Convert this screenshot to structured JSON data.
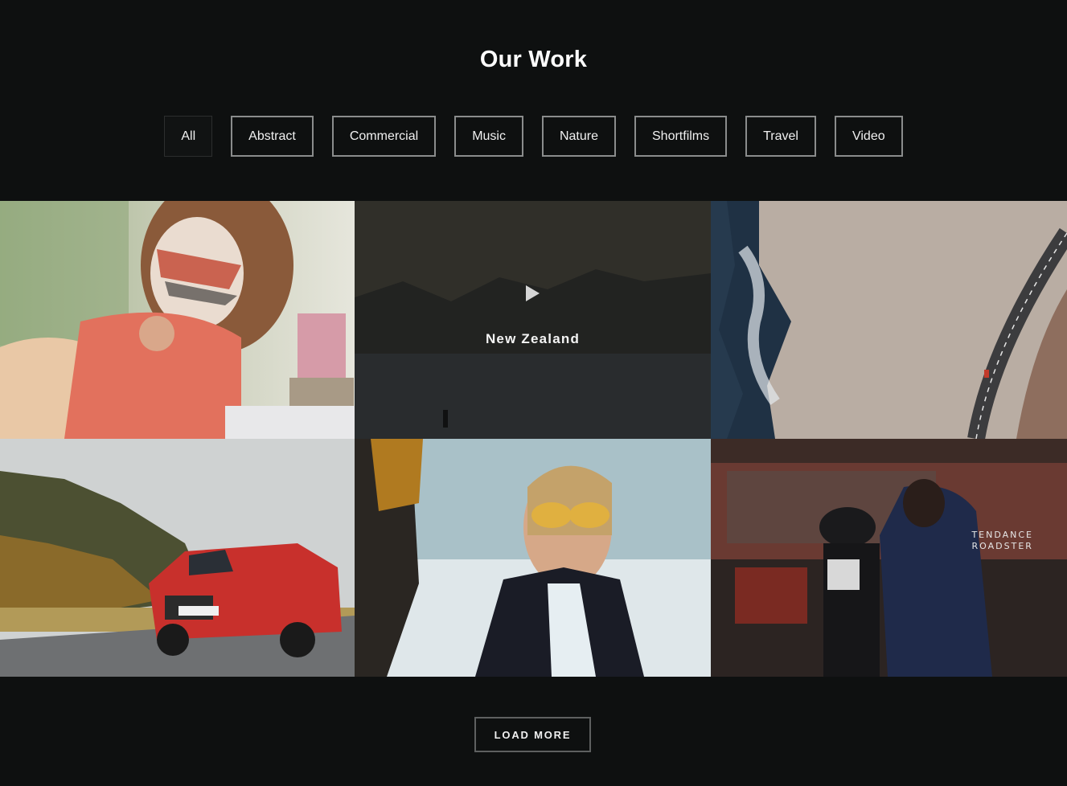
{
  "section": {
    "title": "Our Work"
  },
  "filters": [
    {
      "label": "All",
      "active": true
    },
    {
      "label": "Abstract",
      "active": false
    },
    {
      "label": "Commercial",
      "active": false
    },
    {
      "label": "Music",
      "active": false
    },
    {
      "label": "Nature",
      "active": false
    },
    {
      "label": "Shortfilms",
      "active": false
    },
    {
      "label": "Travel",
      "active": false
    },
    {
      "label": "Video",
      "active": false
    }
  ],
  "portfolio": {
    "hover_item": {
      "title": "New Zealand",
      "icon": "play-icon"
    },
    "roadster_watermark": {
      "line1": "TENDANCE",
      "line2": "ROADSTER"
    }
  },
  "load_more_label": "LOAD MORE",
  "colors": {
    "background": "#0e1010",
    "button_border": "#8a8c8c",
    "text": "#ffffff"
  }
}
